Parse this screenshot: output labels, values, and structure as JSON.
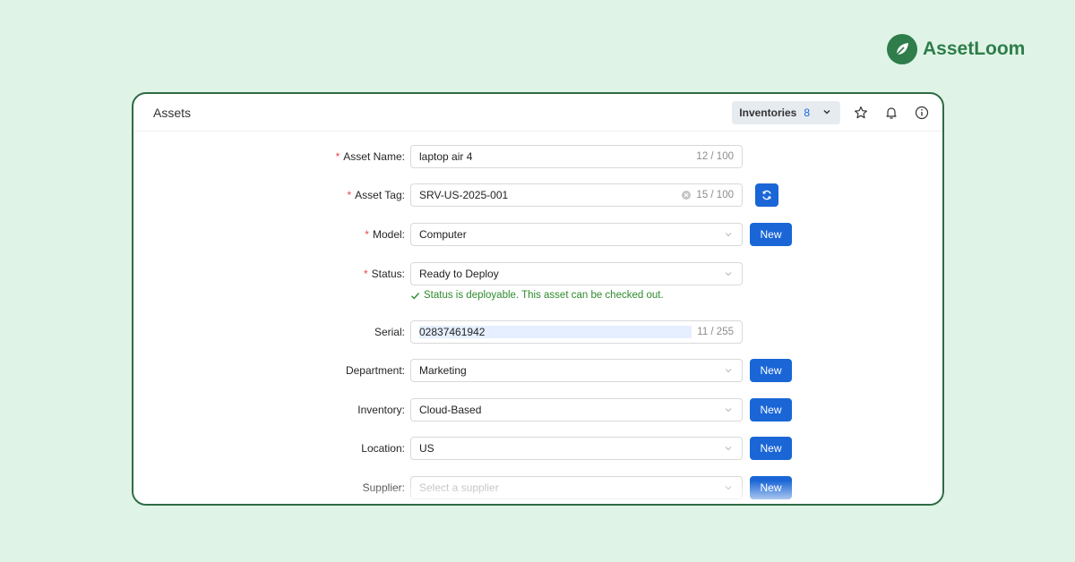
{
  "brand": {
    "name": "AssetLoom",
    "logo_icon": "leaf-icon",
    "color": "#2e7d4a"
  },
  "header": {
    "title": "Assets",
    "inventory_selector": {
      "label": "Inventories",
      "count": "8"
    },
    "icons": [
      "star-icon",
      "bell-icon",
      "info-icon"
    ]
  },
  "form": {
    "asset_name": {
      "label": "Asset Name",
      "required": true,
      "value": "laptop air 4",
      "count": "12 / 100"
    },
    "asset_tag": {
      "label": "Asset Tag",
      "required": true,
      "value": "SRV-US-2025-001",
      "count": "15 / 100"
    },
    "model": {
      "label": "Model",
      "required": true,
      "value": "Computer",
      "button": "New"
    },
    "status": {
      "label": "Status",
      "required": true,
      "value": "Ready to Deploy",
      "help": "Status is deployable. This asset can be checked out."
    },
    "serial": {
      "label": "Serial",
      "value": "02837461942",
      "count": "11 / 255"
    },
    "department": {
      "label": "Department",
      "value": "Marketing",
      "button": "New"
    },
    "inventory": {
      "label": "Inventory",
      "value": "Cloud-Based",
      "button": "New"
    },
    "location": {
      "label": "Location",
      "value": "US",
      "button": "New"
    },
    "supplier": {
      "label": "Supplier",
      "placeholder": "Select a supplier",
      "button": "New"
    }
  },
  "colors": {
    "primary": "#1a66d6",
    "success": "#2e8b2e",
    "required": "#e5484d",
    "frame": "#2e6b45",
    "background": "#dff4e6"
  }
}
